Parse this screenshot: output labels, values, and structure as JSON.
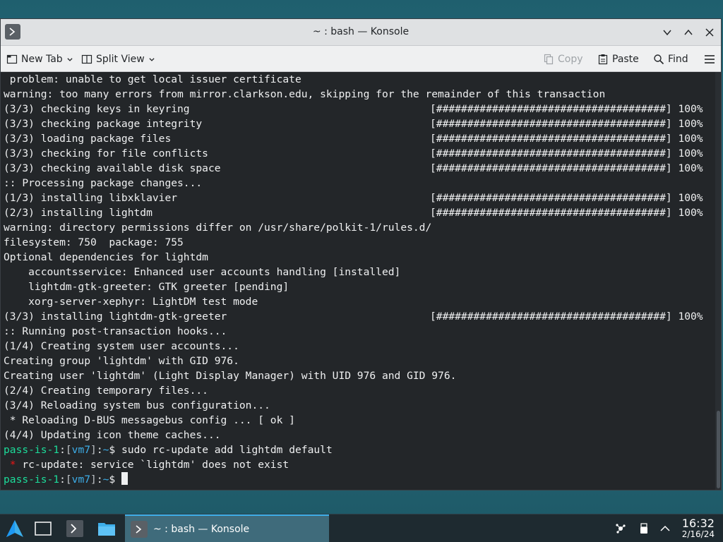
{
  "window": {
    "title": "~ : bash — Konsole"
  },
  "toolbar": {
    "new_tab": "New Tab",
    "split_view": "Split View",
    "copy": "Copy",
    "paste": "Paste",
    "find": "Find"
  },
  "terminal": {
    "lines": [
      " problem: unable to get local issuer certificate",
      "warning: too many errors from mirror.clarkson.edu, skipping for the remainder of this transaction",
      "(3/3) checking keys in keyring",
      "(3/3) checking package integrity",
      "(3/3) loading package files",
      "(3/3) checking for file conflicts",
      "(3/3) checking available disk space",
      ":: Processing package changes...",
      "(1/3) installing libxklavier",
      "(2/3) installing lightdm",
      "warning: directory permissions differ on /usr/share/polkit-1/rules.d/",
      "filesystem: 750  package: 755",
      "Optional dependencies for lightdm",
      "    accountsservice: Enhanced user accounts handling [installed]",
      "    lightdm-gtk-greeter: GTK greeter [pending]",
      "    xorg-server-xephyr: LightDM test mode",
      "(3/3) installing lightdm-gtk-greeter",
      ":: Running post-transaction hooks...",
      "(1/4) Creating system user accounts...",
      "Creating group 'lightdm' with GID 976.",
      "Creating user 'lightdm' (Light Display Manager) with UID 976 and GID 976.",
      "(2/4) Creating temporary files...",
      "(3/4) Reloading system bus configuration...",
      " * Reloading D-BUS messagebus config ... [ ok ]",
      "(4/4) Updating icon theme caches..."
    ],
    "progress_bar": "[#####################################] 100%",
    "progress_lines": [
      2,
      3,
      4,
      5,
      6,
      8,
      9,
      16
    ],
    "prompt": {
      "user": "pass-is-1",
      "sep1": ":",
      "lb": "[",
      "host": "vm7",
      "rb": "]",
      "sep2": ":",
      "path": "~",
      "dollar": "$"
    },
    "command": " sudo rc-update add lightdm default",
    "error_star": " *",
    "error_text": " rc-update: service `lightdm' does not exist"
  },
  "taskbar": {
    "task_label": "~ : bash — Konsole",
    "time": "16:32",
    "date": "2/16/24"
  },
  "colors": {
    "prompt_user": "#1cdc9a",
    "prompt_host": "#3daee9",
    "error": "#ed1515",
    "accent": "#3daee9"
  }
}
